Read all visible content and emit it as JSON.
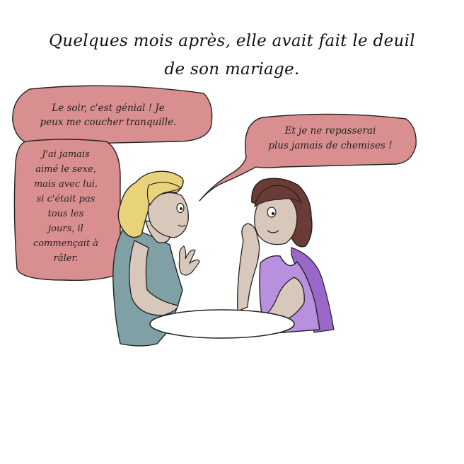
{
  "caption": {
    "line1": "Quelques mois après, elle avait fait le deuil",
    "line2": "de son mariage."
  },
  "bubbles": {
    "top_left": {
      "lines": [
        "Le soir, c'est génial ! Je",
        "peux me coucher tranquille."
      ]
    },
    "left": {
      "lines": [
        "J'ai jamais",
        "aimé le sexe,",
        "mais avec lui,",
        "si c'était pas",
        "tous les",
        "jours, il",
        "commençait à",
        "râler."
      ]
    },
    "right": {
      "lines": [
        "Et je ne repasserai",
        "plus jamais de chemises !"
      ]
    }
  },
  "colors": {
    "bubble": "#d98f8f",
    "blonde_hair": "#e8d27a",
    "brunette_hair": "#6b3b35",
    "skin": "#d8c8bb",
    "blue_top": "#7fa0a4",
    "purple_top": "#b98fe0",
    "purple_top_shade": "#9a68c8",
    "table": "#ffffff"
  }
}
